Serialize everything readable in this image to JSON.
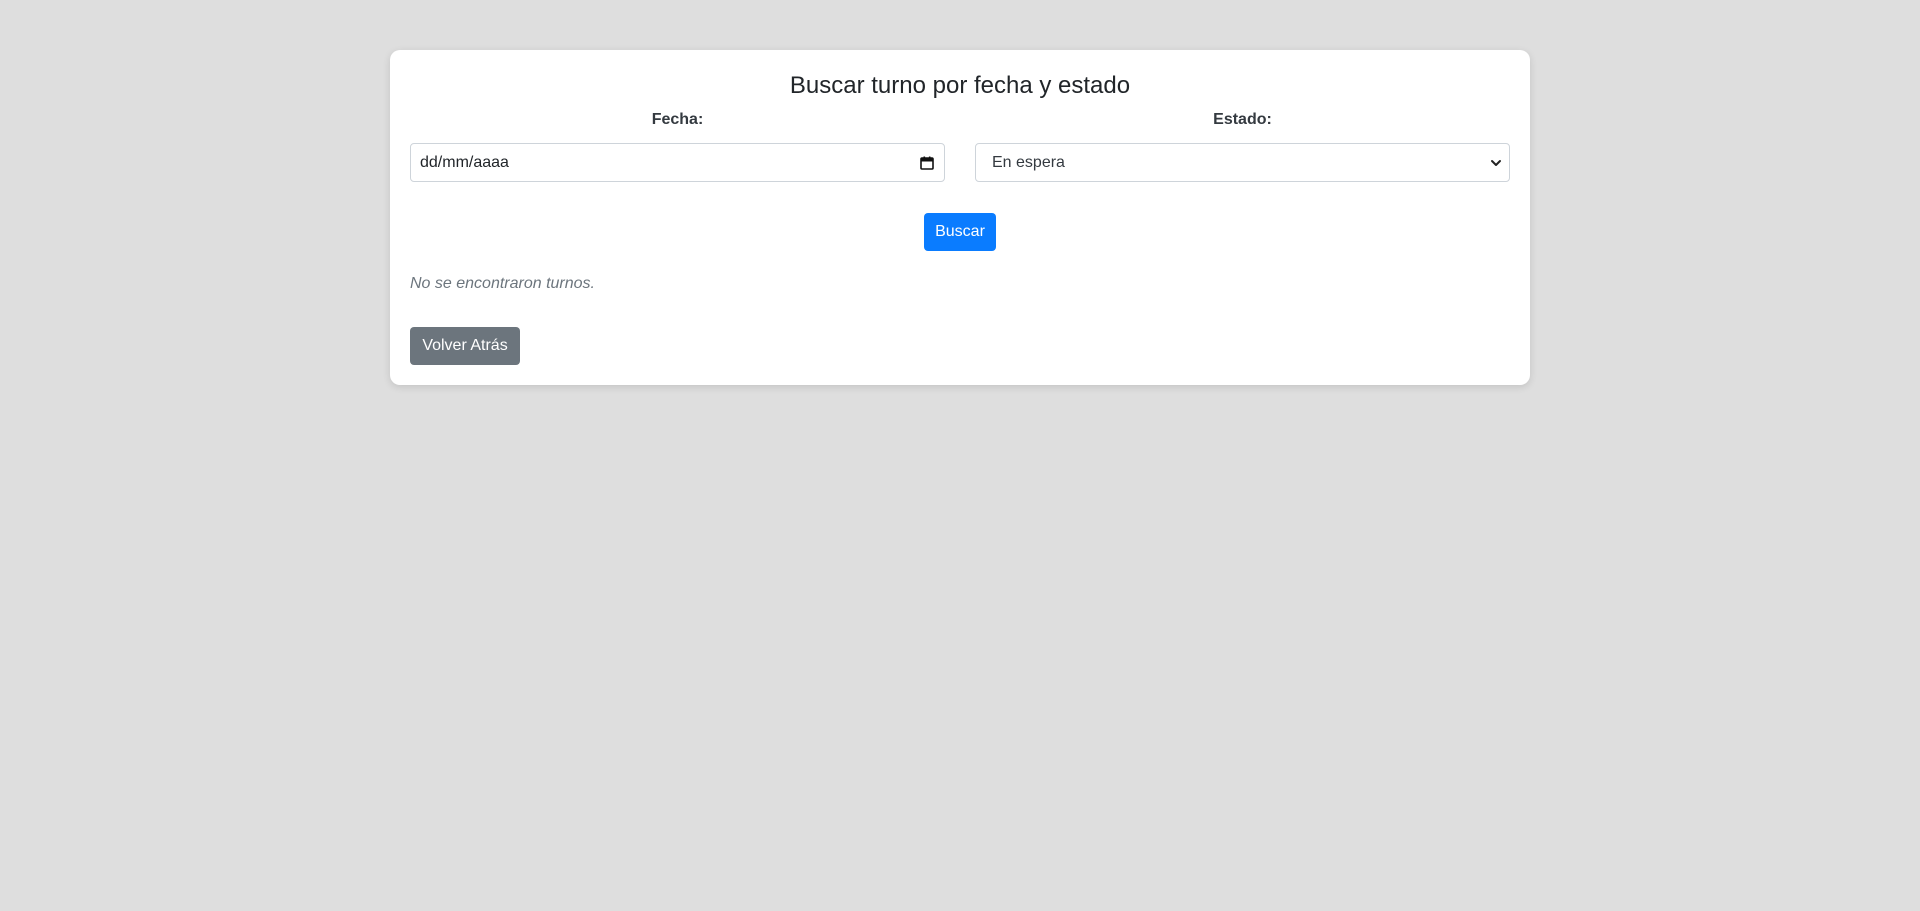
{
  "card": {
    "title": "Buscar turno por fecha y estado"
  },
  "fecha": {
    "label": "Fecha:",
    "placeholder": "dd/mm/aaaa",
    "icon": "calendar-icon"
  },
  "estado": {
    "label": "Estado:",
    "selected": "En espera",
    "icon": "chevron-down-icon"
  },
  "actions": {
    "search_label": "Buscar",
    "back_label": "Volver Atrás"
  },
  "results": {
    "empty_message": "No se encontraron turnos."
  },
  "colors": {
    "background": "#dedede",
    "primary": "#0a7cff",
    "secondary": "#6c757d"
  }
}
